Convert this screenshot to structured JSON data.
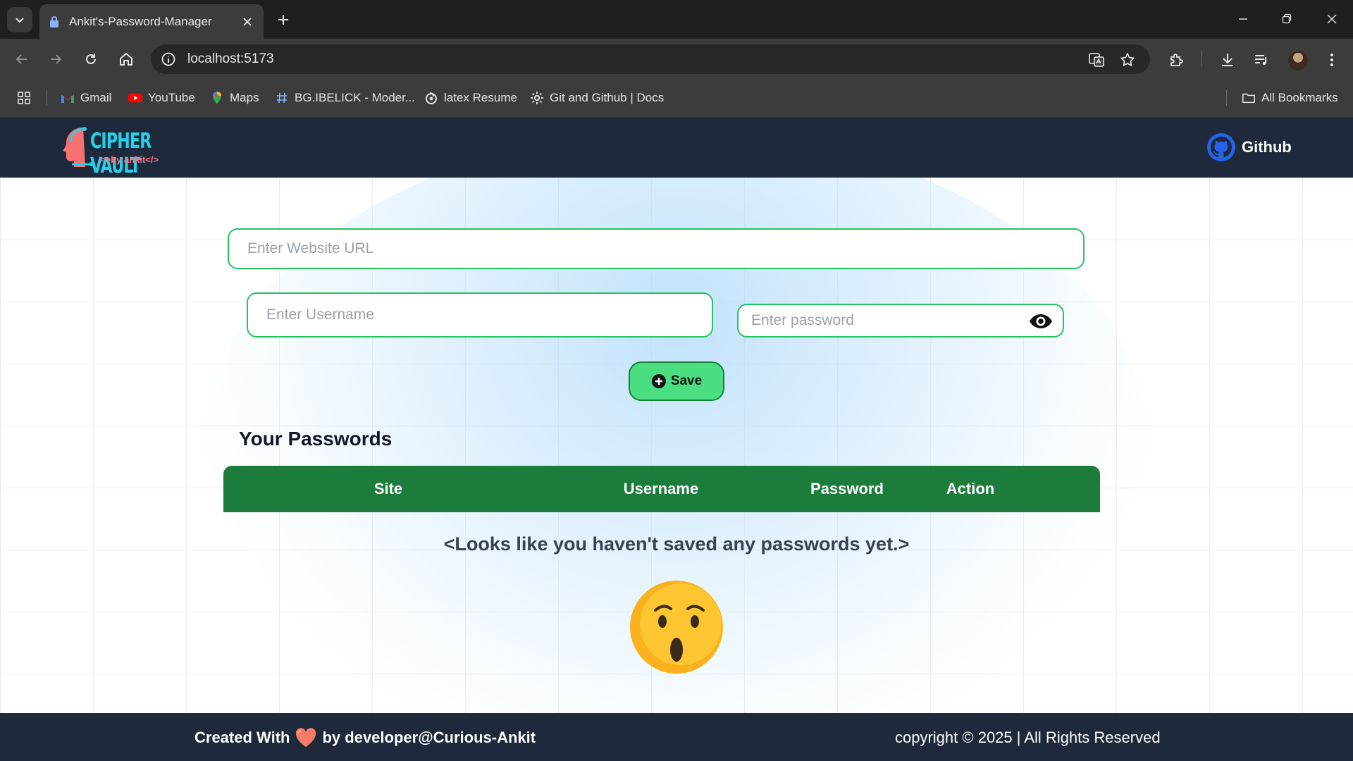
{
  "browser": {
    "tab_title": "Ankit's-Password-Manager",
    "url": "localhost:5173",
    "bookmarks": [
      {
        "label": "Gmail",
        "icon": "gmail-icon"
      },
      {
        "label": "YouTube",
        "icon": "youtube-icon"
      },
      {
        "label": "Maps",
        "icon": "maps-icon"
      },
      {
        "label": "BG.IBELICK - Moder...",
        "icon": "hash-icon"
      },
      {
        "label": "latex Resume",
        "icon": "overleaf-icon"
      },
      {
        "label": "Git and Github | Docs",
        "icon": "gear-icon"
      }
    ],
    "all_bookmarks": "All Bookmarks"
  },
  "header": {
    "logo_title": "CIPHER VAULT",
    "logo_subtitle": "<>by ankit</>",
    "github_label": "Github"
  },
  "form": {
    "url_placeholder": "Enter Website URL",
    "username_placeholder": "Enter Username",
    "password_placeholder": "Enter password",
    "save_label": "Save"
  },
  "passwords": {
    "title": "Your Passwords",
    "columns": [
      "Site",
      "Username",
      "Password",
      "Action"
    ],
    "empty_message": "<Looks like you haven't saved any passwords yet.>"
  },
  "footer": {
    "created_prefix": "Created With",
    "created_suffix": "by developer@Curious-Ankit",
    "copyright": "copyright © 2025 | All Rights Reserved"
  },
  "colors": {
    "header_bg": "#1e293b",
    "accent_green": "#22c55e",
    "table_header": "#1c7c3c",
    "save_button": "#4ade80",
    "logo_cyan": "#22d3ee"
  }
}
